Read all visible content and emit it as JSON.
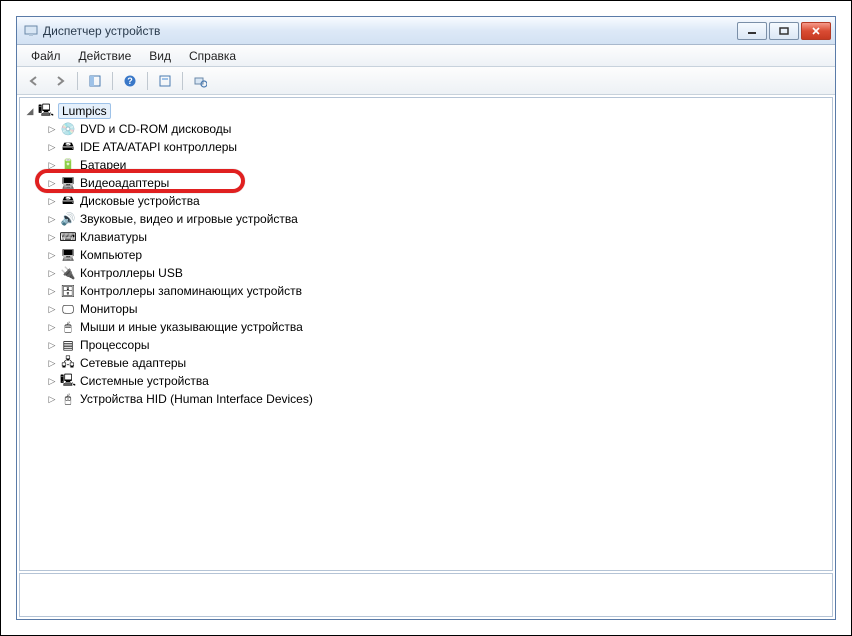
{
  "window": {
    "title": "Диспетчер устройств"
  },
  "menu": {
    "file": "Файл",
    "action": "Действие",
    "view": "Вид",
    "help": "Справка"
  },
  "tree": {
    "root": "Lumpics",
    "items": [
      "DVD и CD-ROM дисководы",
      "IDE ATA/ATAPI контроллеры",
      "Батареи",
      "Видеоадаптеры",
      "Дисковые устройства",
      "Звуковые, видео и игровые устройства",
      "Клавиатуры",
      "Компьютер",
      "Контроллеры USB",
      "Контроллеры запоминающих устройств",
      "Мониторы",
      "Мыши и иные указывающие устройства",
      "Процессоры",
      "Сетевые адаптеры",
      "Системные устройства",
      "Устройства HID (Human Interface Devices)"
    ]
  },
  "icons": {
    "dvd": "💿",
    "ide": "🖴",
    "battery": "🔋",
    "video": "🖥",
    "disk": "🖴",
    "sound": "🔊",
    "keyboard": "⌨",
    "computer": "🖥",
    "usb": "🔌",
    "storage": "🗄",
    "monitor": "🖵",
    "mouse": "🖱",
    "cpu": "▤",
    "network": "🖧",
    "system": "🖳",
    "hid": "🖰",
    "pc": "🖳"
  },
  "highlight_index": 3
}
